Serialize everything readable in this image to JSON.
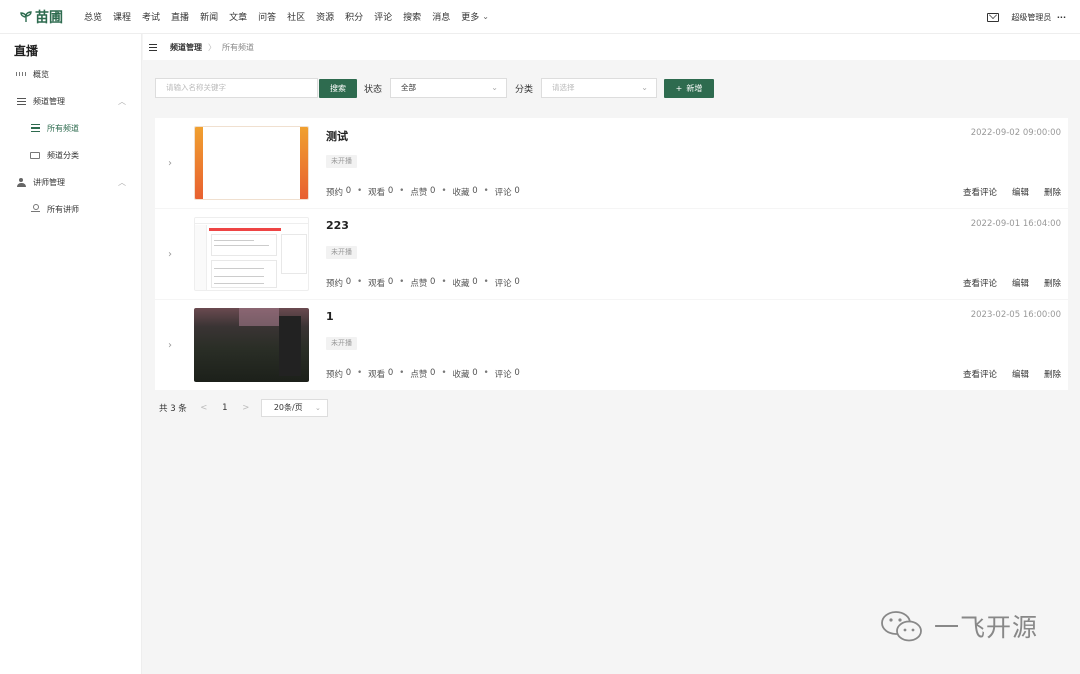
{
  "brand": {
    "name": "苗圃",
    "accent": "#2e6b4f"
  },
  "topnav": {
    "items": [
      "总览",
      "课程",
      "考试",
      "直播",
      "新闻",
      "文章",
      "问答",
      "社区",
      "资源",
      "积分",
      "评论",
      "搜索",
      "消息"
    ],
    "more": "更多",
    "user": "超级管理员",
    "user_more": "···"
  },
  "sidebar": {
    "title": "直播",
    "overview": "概览",
    "channel_group": "频道管理",
    "all_channels": "所有频道",
    "channel_categories": "频道分类",
    "lecturer_group": "讲师管理",
    "all_lecturers": "所有讲师"
  },
  "breadcrumb": {
    "parent": "频道管理",
    "separator": "〉",
    "current": "所有频道"
  },
  "filters": {
    "search_placeholder": "请输入名称关键字",
    "search_button": "搜索",
    "status_label": "状态",
    "status_value": "全部",
    "category_label": "分类",
    "category_placeholder": "请选择",
    "add_button": "新增",
    "add_icon": "+"
  },
  "stat_labels": {
    "reserve": "预约",
    "view": "观看",
    "like": "点赞",
    "favorite": "收藏",
    "comment": "评论"
  },
  "action_labels": {
    "view_comments": "查看评论",
    "edit": "编辑",
    "delete": "删除"
  },
  "channels": [
    {
      "title": "测试",
      "date": "2022-09-02 09:00:00",
      "status": "未开播",
      "reserve": "0",
      "view": "0",
      "like": "0",
      "favorite": "0",
      "comment": "0"
    },
    {
      "title": "223",
      "date": "2022-09-01 16:04:00",
      "status": "未开播",
      "reserve": "0",
      "view": "0",
      "like": "0",
      "favorite": "0",
      "comment": "0"
    },
    {
      "title": "1",
      "date": "2023-02-05 16:00:00",
      "status": "未开播",
      "reserve": "0",
      "view": "0",
      "like": "0",
      "favorite": "0",
      "comment": "0"
    }
  ],
  "pagination": {
    "total": "共 3 条",
    "prev": "<",
    "page": "1",
    "next": ">",
    "page_size": "20条/页"
  },
  "watermark": {
    "text": "一飞开源"
  }
}
